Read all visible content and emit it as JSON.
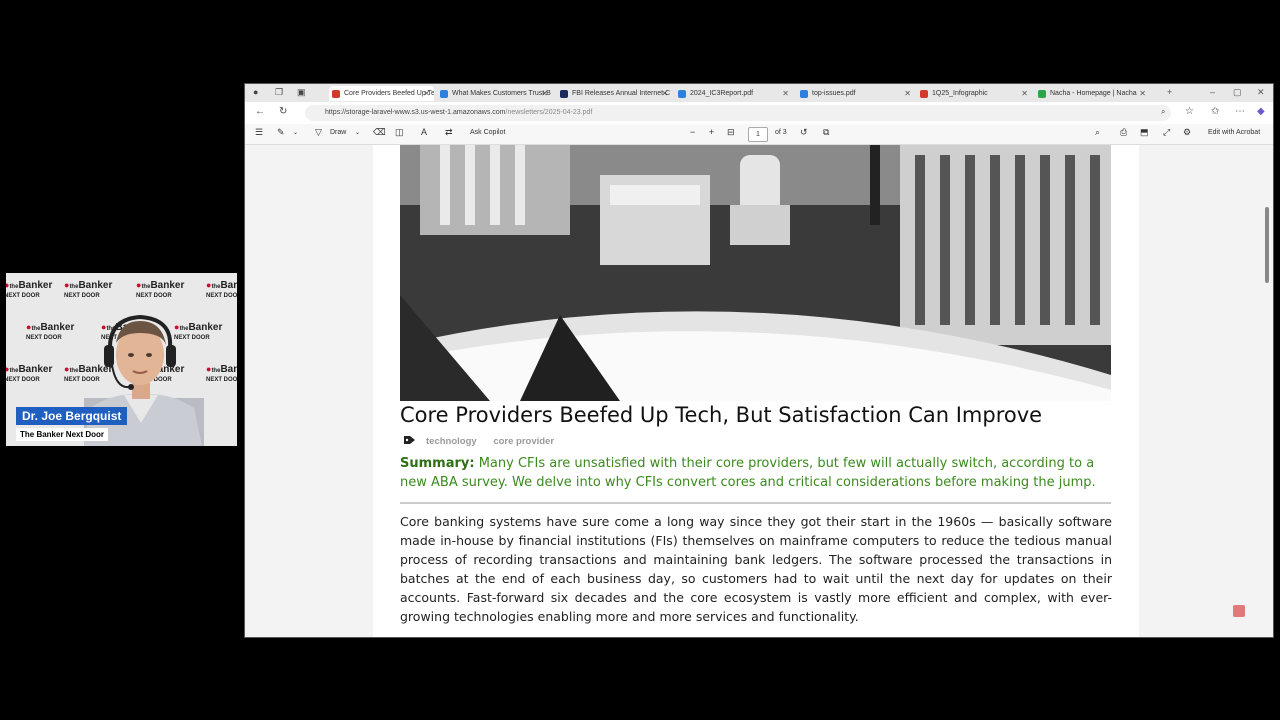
{
  "webcam": {
    "show_logo": {
      "line1": "Banker",
      "line2": "NEXT DOOR",
      "prefix": "the"
    },
    "presenter_name": "Dr. Joe Bergquist",
    "show_name": "The Banker Next Door"
  },
  "browser": {
    "tabs": [
      {
        "label": "Core Providers Beefed Up Tech",
        "active": true,
        "fav_color": "#d23b2a"
      },
      {
        "label": "What Makes Customers Trust B",
        "active": false,
        "fav_color": "#2d7fe0"
      },
      {
        "label": "FBI Releases Annual Internet C",
        "active": false,
        "fav_color": "#1a2a5a"
      },
      {
        "label": "2024_IC3Report.pdf",
        "active": false,
        "fav_color": "#2d7fe0"
      },
      {
        "label": "top-issues.pdf",
        "active": false,
        "fav_color": "#2d7fe0"
      },
      {
        "label": "1Q25_Infographic",
        "active": false,
        "fav_color": "#d23b2a"
      },
      {
        "label": "Nacha - Homepage | Nacha",
        "active": false,
        "fav_color": "#2fa34a"
      }
    ],
    "new_tab": "+",
    "close_glyph": "✕",
    "url_host": "https://storage-laravel-www.s3.us-west-1.amazonaws.com",
    "url_path": "/newsletters/2025-04-23.pdf",
    "pdf_toolbar": {
      "draw": "Draw",
      "ask_copilot": "Ask Copilot",
      "zoom_out": "−",
      "zoom_in": "+",
      "page_current": "1",
      "page_total": "of 3",
      "edit_acrobat": "Edit with Acrobat"
    }
  },
  "article": {
    "title": "Core Providers Beefed Up Tech, But Satisfaction Can Improve",
    "tags": [
      "technology",
      "core provider"
    ],
    "summary_label": "Summary:",
    "summary_text": "Many CFIs are unsatisfied with their core providers, but few will actually switch, according to a new ABA survey. We delve into why CFIs convert cores and critical considerations before making the jump.",
    "body": "Core banking systems have sure come a long way since they got their start in the 1960s — basically software made in-house by financial institutions (FIs) themselves on mainframe computers to reduce the tedious manual process of recording transactions and maintaining bank ledgers. The software processed the transactions in batches at the end of each business day, so customers had to wait until the next day for updates on their accounts. Fast-forward six decades and the core ecosystem is vastly more efficient and complex, with ever-growing technologies enabling more and more services and functionality."
  }
}
